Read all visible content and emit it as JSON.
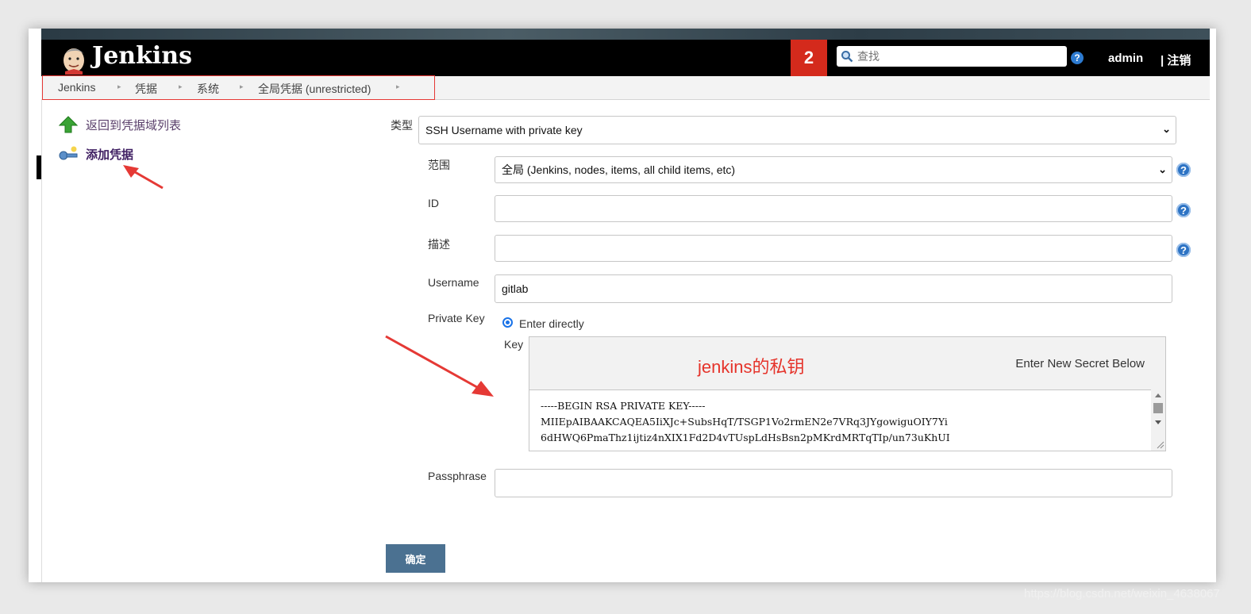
{
  "header": {
    "logo_text": "Jenkins",
    "notification_count": "2",
    "search_placeholder": "查找",
    "help_symbol": "?",
    "user": "admin",
    "logout": "| 注销"
  },
  "breadcrumb": [
    "Jenkins",
    "凭据",
    "系统",
    "全局凭据 (unrestricted)"
  ],
  "sidebar": {
    "back_link": "返回到凭据域列表",
    "add_credential": "添加凭据"
  },
  "form": {
    "kind_label": "类型",
    "kind_value": "SSH Username with private key",
    "scope_label": "范围",
    "scope_value": "全局 (Jenkins, nodes, items, all child items, etc)",
    "id_label": "ID",
    "id_value": "",
    "description_label": "描述",
    "description_value": "",
    "username_label": "Username",
    "username_value": "gitlab",
    "private_key_label": "Private Key",
    "enter_directly": "Enter directly",
    "key_label": "Key",
    "key_annotation": "jenkins的私钥",
    "enter_new_secret": "Enter New Secret Below",
    "key_text": "-----BEGIN RSA PRIVATE KEY-----\nMIIEpAIBAAKCAQEA5IiXJc+SubsHqT/TSGP1Vo2rmEN2e7VRq3JYgowiguOIY7Yi\n6dHWQ6PmaThz1ijtiz4nXIX1Fd2D4vTUspLdHsBsn2pMKrdMRTqTIp/un73uKhUI",
    "passphrase_label": "Passphrase",
    "passphrase_value": "",
    "submit": "确定"
  },
  "watermark": "https://blog.csdn.net/weixin_4638067",
  "colors": {
    "header_bg": "#000000",
    "badge_red": "#d42a1c",
    "annotation_red": "#e5332a",
    "submit_bg": "#4b7191"
  }
}
